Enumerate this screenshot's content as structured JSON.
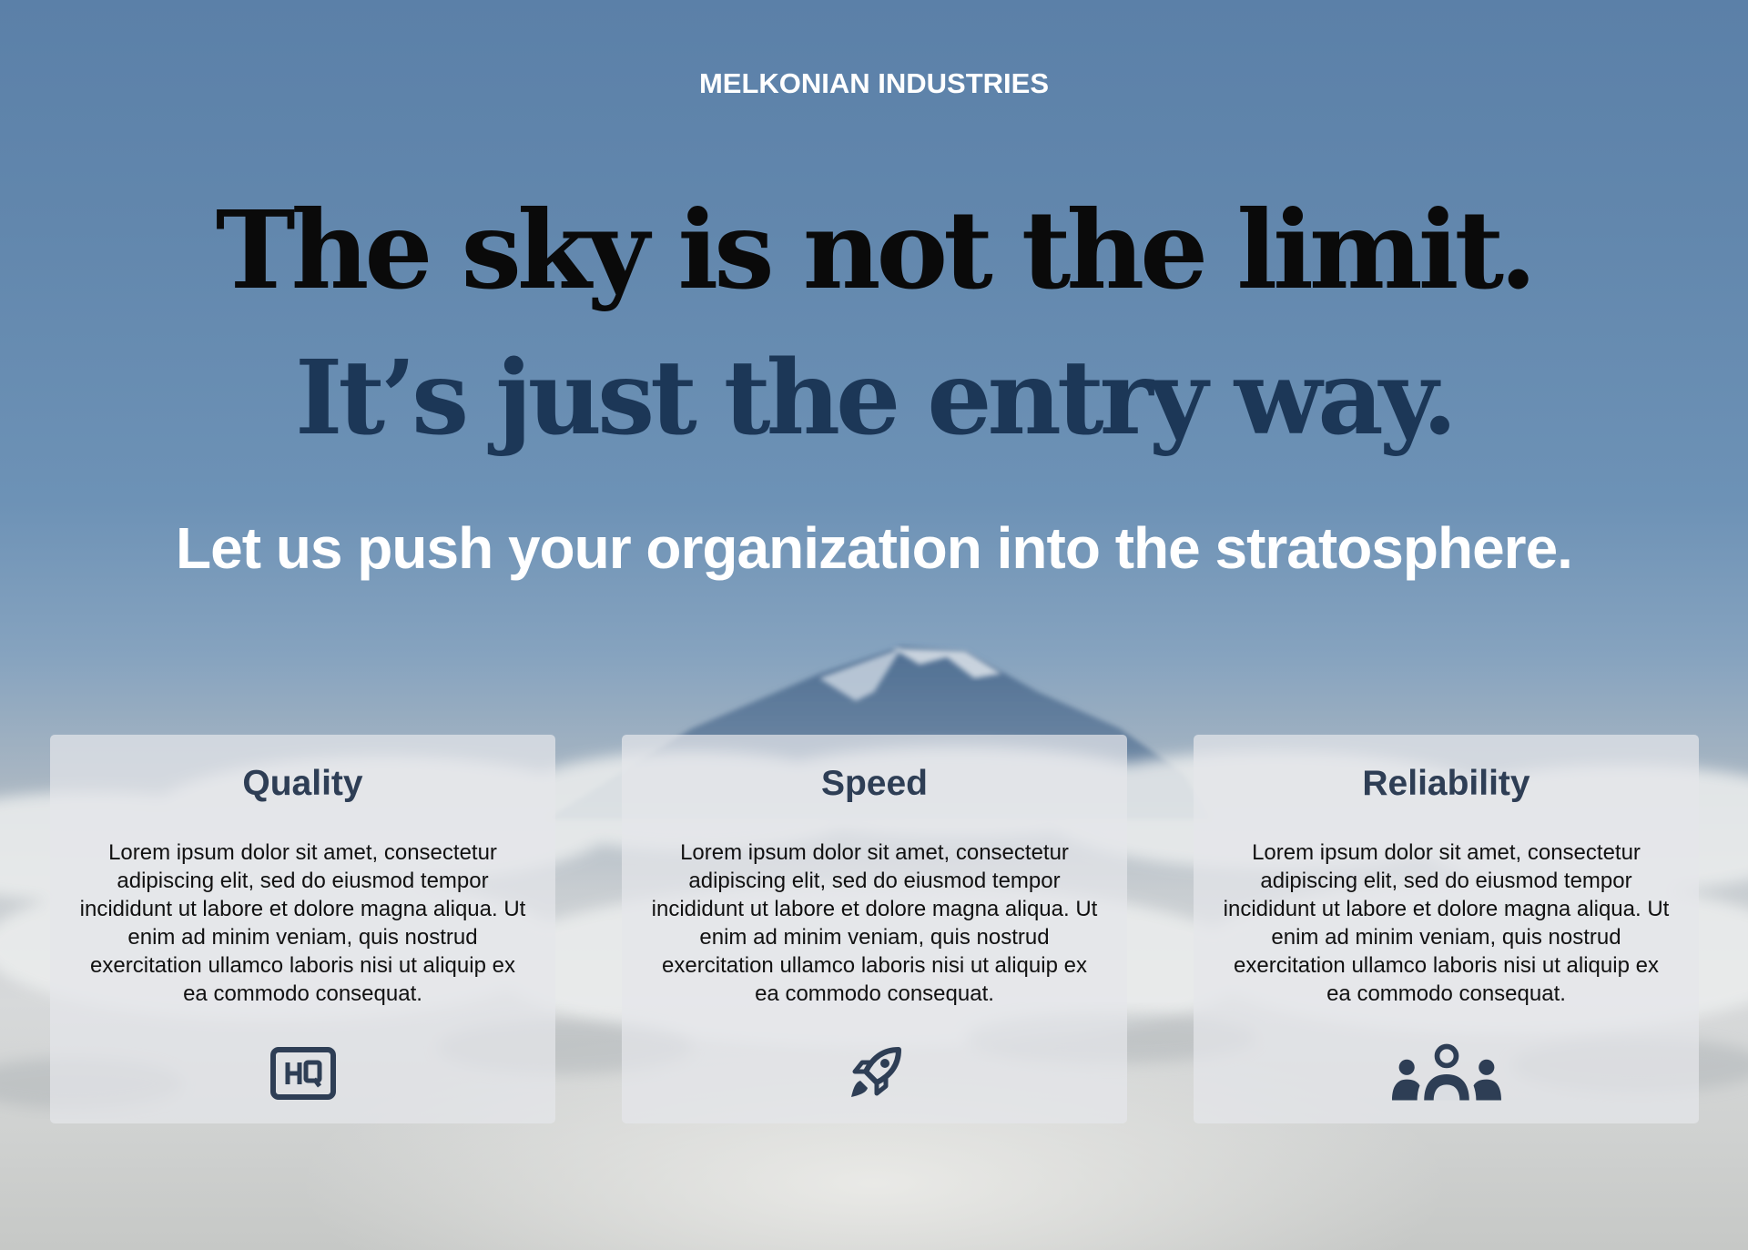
{
  "brand": "MELKONIAN INDUSTRIES",
  "hero": {
    "headline_1": "The sky is not the limit.",
    "headline_2": "It’s just the entry way.",
    "tagline": "Let us push your organization into the stratosphere."
  },
  "features": [
    {
      "title": "Quality",
      "text": "Lorem ipsum dolor sit amet, consectetur adipiscing elit, sed do eiusmod tempor incididunt ut labore et dolore magna aliqua. Ut enim ad minim veniam, quis nostrud exercitation ullamco laboris nisi ut aliquip ex ea commodo consequat.",
      "icon": "hq-icon"
    },
    {
      "title": "Speed",
      "text": "Lorem ipsum dolor sit amet, consectetur adipiscing elit, sed do eiusmod tempor incididunt ut labore et dolore magna aliqua. Ut enim ad minim veniam, quis nostrud exercitation ullamco laboris nisi ut aliquip ex ea commodo consequat.",
      "icon": "rocket-icon"
    },
    {
      "title": "Reliability",
      "text": "Lorem ipsum dolor sit amet, consectetur adipiscing elit, sed do eiusmod tempor incididunt ut labore et dolore magna aliqua. Ut enim ad minim veniam, quis nostrud exercitation ullamco laboris nisi ut aliquip ex ea commodo consequat.",
      "icon": "users-icon"
    }
  ],
  "colors": {
    "headline_primary": "#0a0a0a",
    "headline_secondary": "#1c3757",
    "card_title": "#2e3e55",
    "icon": "#2e3e55"
  }
}
